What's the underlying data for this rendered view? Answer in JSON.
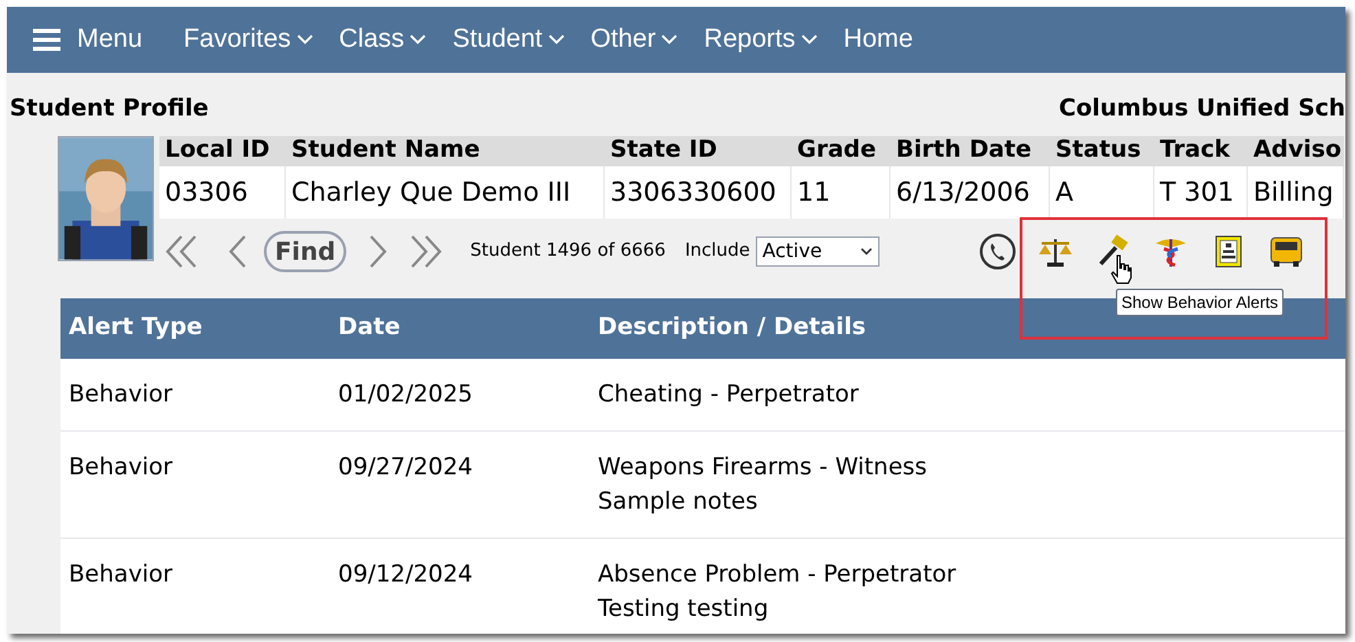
{
  "nav": {
    "menu_label": "Menu",
    "items": [
      {
        "label": "Favorites",
        "dropdown": true
      },
      {
        "label": "Class",
        "dropdown": true
      },
      {
        "label": "Student",
        "dropdown": true
      },
      {
        "label": "Other",
        "dropdown": true
      },
      {
        "label": "Reports",
        "dropdown": true
      },
      {
        "label": "Home",
        "dropdown": false
      }
    ]
  },
  "profile": {
    "title": "Student Profile",
    "school": "Columbus Unified Sch"
  },
  "student": {
    "columns": [
      "Local ID",
      "Student Name",
      "State ID",
      "Grade",
      "Birth Date",
      "Status",
      "Track",
      "Adviso"
    ],
    "values": [
      "03306",
      "Charley Que Demo III",
      "3306330600",
      "11",
      "6/13/2006",
      "A",
      "T 301",
      "Billing"
    ]
  },
  "navigator": {
    "find": "Find",
    "counter": "Student 1496 of 6666",
    "include_label": "Include",
    "include_value": "Active"
  },
  "tooltip": "Show Behavior Alerts",
  "alerts": {
    "columns": [
      "Alert Type",
      "Date",
      "Description / Details"
    ],
    "rows": [
      {
        "type": "Behavior",
        "date": "01/02/2025",
        "description": "Cheating - Perpetrator"
      },
      {
        "type": "Behavior",
        "date": "09/27/2024",
        "description": "Weapons Firearms - Witness",
        "details": "Sample notes"
      },
      {
        "type": "Behavior",
        "date": "09/12/2024",
        "description": "Absence Problem - Perpetrator",
        "details": "Testing testing"
      }
    ]
  }
}
